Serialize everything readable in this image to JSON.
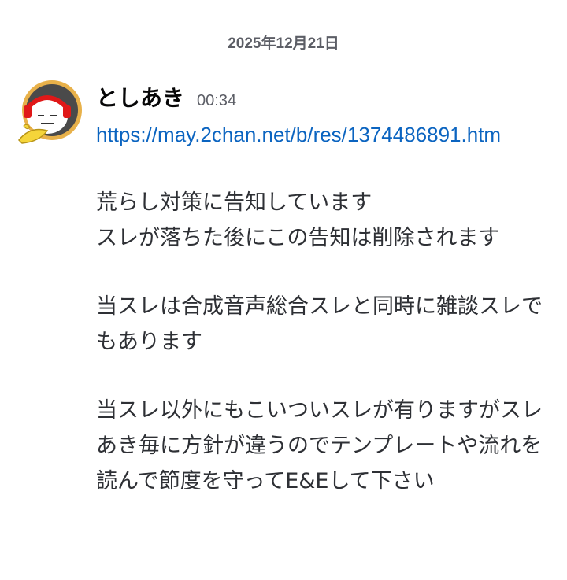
{
  "divider": {
    "date": "2025年12月21日"
  },
  "message": {
    "author": "としあき",
    "time": "00:34",
    "link": "https://may.2chan.net/b/res/1374486891.htm",
    "paragraphs": [
      [
        "荒らし対策に告知しています",
        "スレが落ちた後にこの告知は削除されます"
      ],
      [
        "当スレは合成音声総合スレと同時に雑談スレでもあります"
      ],
      [
        "当スレ以外にもこいついスレが有りますがスレあき毎に方針が違うのでテンプレートや流れを読んで節度を守ってE&Eして下さい"
      ]
    ],
    "avatar_icon": "banana-ghost-avatar-icon"
  },
  "colors": {
    "link": "#0b64c0",
    "text": "#2e3035",
    "muted": "#5c5e66",
    "divider": "#c9cbcf"
  }
}
